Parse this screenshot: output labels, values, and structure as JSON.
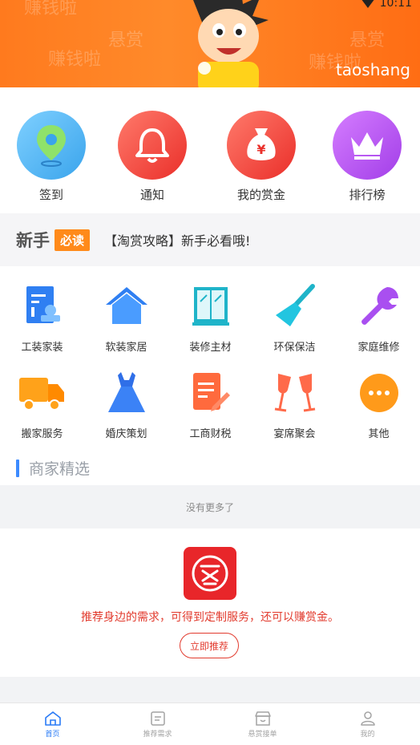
{
  "status": {
    "time": "10:11"
  },
  "banner": {
    "brand": "taoshang",
    "watermarks": [
      "赚钱啦",
      "悬赏",
      "赚钱啦",
      "悬赏",
      "赚钱啦"
    ]
  },
  "quick_actions": [
    {
      "label": "签到",
      "icon": "location-pin-icon",
      "color": "#4fb3ef"
    },
    {
      "label": "通知",
      "icon": "bell-icon",
      "color": "#f2473c"
    },
    {
      "label": "我的赏金",
      "icon": "money-bag-icon",
      "color": "#f2473c"
    },
    {
      "label": "排行榜",
      "icon": "crown-icon",
      "color": "#b64ef0"
    }
  ],
  "notice": {
    "title": "新手",
    "tag": "必读",
    "message": "【淘赏攻略】新手必看哦!"
  },
  "services": [
    {
      "label": "工装家装",
      "icon": "document-stamp-icon"
    },
    {
      "label": "软装家居",
      "icon": "house-icon"
    },
    {
      "label": "装修主材",
      "icon": "cabinet-icon"
    },
    {
      "label": "环保保洁",
      "icon": "broom-icon"
    },
    {
      "label": "家庭维修",
      "icon": "wrench-icon"
    },
    {
      "label": "搬家服务",
      "icon": "truck-icon"
    },
    {
      "label": "婚庆策划",
      "icon": "dress-icon"
    },
    {
      "label": "工商财税",
      "icon": "form-pen-icon"
    },
    {
      "label": "宴席聚会",
      "icon": "cheers-glasses-icon"
    },
    {
      "label": "其他",
      "icon": "more-dots-icon"
    }
  ],
  "section": {
    "title": "商家精选"
  },
  "no_more": "没有更多了",
  "promo": {
    "text": "推荐身边的需求，可得到定制服务，还可以赚赏金。",
    "button": "立即推荐"
  },
  "bottom_nav": [
    {
      "label": "首页",
      "icon": "home-icon",
      "active": true
    },
    {
      "label": "推荐需求",
      "icon": "list-icon",
      "active": false
    },
    {
      "label": "悬赏接单",
      "icon": "shop-icon",
      "active": false
    },
    {
      "label": "我的",
      "icon": "user-icon",
      "active": false
    }
  ]
}
